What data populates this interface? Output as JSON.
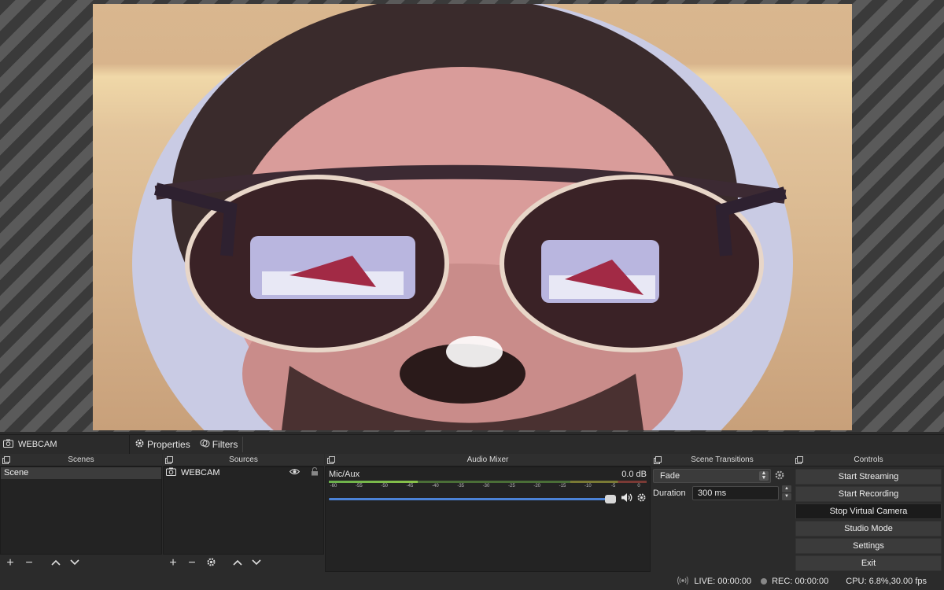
{
  "source_toolbar": {
    "source_name": "WEBCAM",
    "properties_label": "Properties",
    "filters_label": "Filters"
  },
  "docks": {
    "scenes": {
      "title": "Scenes",
      "items": [
        {
          "label": "Scene"
        }
      ]
    },
    "sources": {
      "title": "Sources",
      "items": [
        {
          "label": "WEBCAM"
        }
      ]
    },
    "audio_mixer": {
      "title": "Audio Mixer",
      "channel_name": "Mic/Aux",
      "level": "0.0 dB",
      "ticks": [
        "-60",
        "-55",
        "-50",
        "-45",
        "-40",
        "-35",
        "-30",
        "-25",
        "-20",
        "-15",
        "-10",
        "-5",
        "0"
      ],
      "volume": 1.0
    },
    "scene_transitions": {
      "title": "Scene Transitions",
      "transition": "Fade",
      "duration_label": "Duration",
      "duration_value": "300 ms"
    },
    "controls": {
      "title": "Controls",
      "buttons": [
        {
          "label": "Start Streaming"
        },
        {
          "label": "Start Recording"
        },
        {
          "label": "Stop Virtual Camera"
        },
        {
          "label": "Studio Mode"
        },
        {
          "label": "Settings"
        },
        {
          "label": "Exit"
        }
      ]
    }
  },
  "status_bar": {
    "live": "LIVE: 00:00:00",
    "rec": "REC: 00:00:00",
    "cpu": "CPU: 6.8%,30.00 fps"
  },
  "colors": {
    "panel_bg": "#2b2b2b",
    "list_bg": "#232323",
    "volume_blue": "#4b82d6",
    "active_button": "#1b1b1b"
  }
}
